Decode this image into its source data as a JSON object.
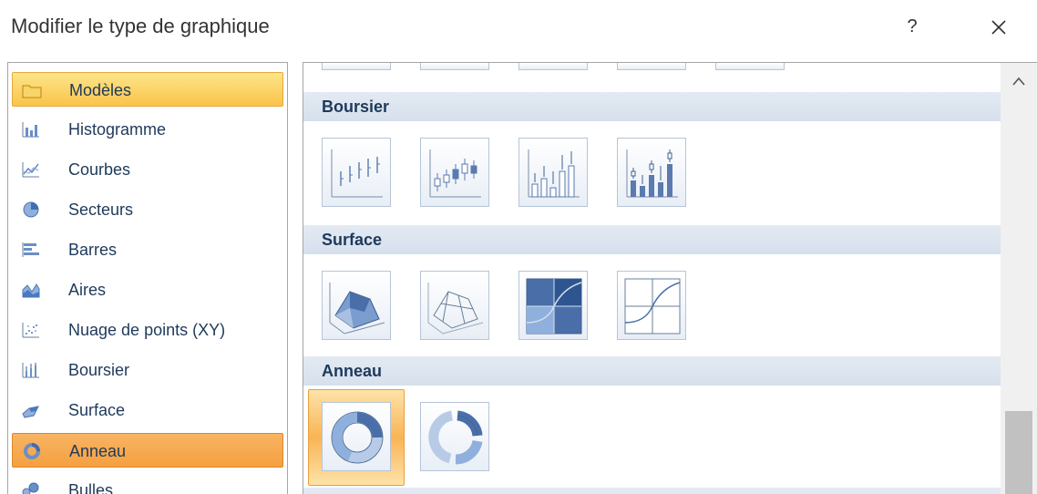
{
  "dialog": {
    "title": "Modifier le type de graphique",
    "help_label": "?"
  },
  "categories": [
    {
      "label": "Modèles",
      "icon": "folder-icon",
      "state": "hover"
    },
    {
      "label": "Histogramme",
      "icon": "column-chart-icon"
    },
    {
      "label": "Courbes",
      "icon": "line-chart-icon"
    },
    {
      "label": "Secteurs",
      "icon": "pie-chart-icon"
    },
    {
      "label": "Barres",
      "icon": "bar-chart-icon"
    },
    {
      "label": "Aires",
      "icon": "area-chart-icon"
    },
    {
      "label": "Nuage de points (XY)",
      "icon": "scatter-chart-icon"
    },
    {
      "label": "Boursier",
      "icon": "stock-chart-icon"
    },
    {
      "label": "Surface",
      "icon": "surface-chart-icon"
    },
    {
      "label": "Anneau",
      "icon": "doughnut-chart-icon",
      "state": "selected"
    },
    {
      "label": "Bulles",
      "icon": "bubble-chart-icon"
    }
  ],
  "sections": [
    {
      "title": "Boursier",
      "thumbs": [
        "high-low-close",
        "open-high-low-close",
        "volume-high-low-close",
        "volume-open-high-low-close"
      ]
    },
    {
      "title": "Surface",
      "thumbs": [
        "3d-surface",
        "wireframe-3d-surface",
        "contour",
        "wireframe-contour"
      ]
    },
    {
      "title": "Anneau",
      "thumbs": [
        "doughnut",
        "exploded-doughnut"
      ],
      "selected": 0
    }
  ],
  "colors": {
    "accent_selected": "#f5a040",
    "accent_hover": "#f9c44a",
    "section_header": "#dde5ef",
    "label_text": "#1e395b"
  }
}
